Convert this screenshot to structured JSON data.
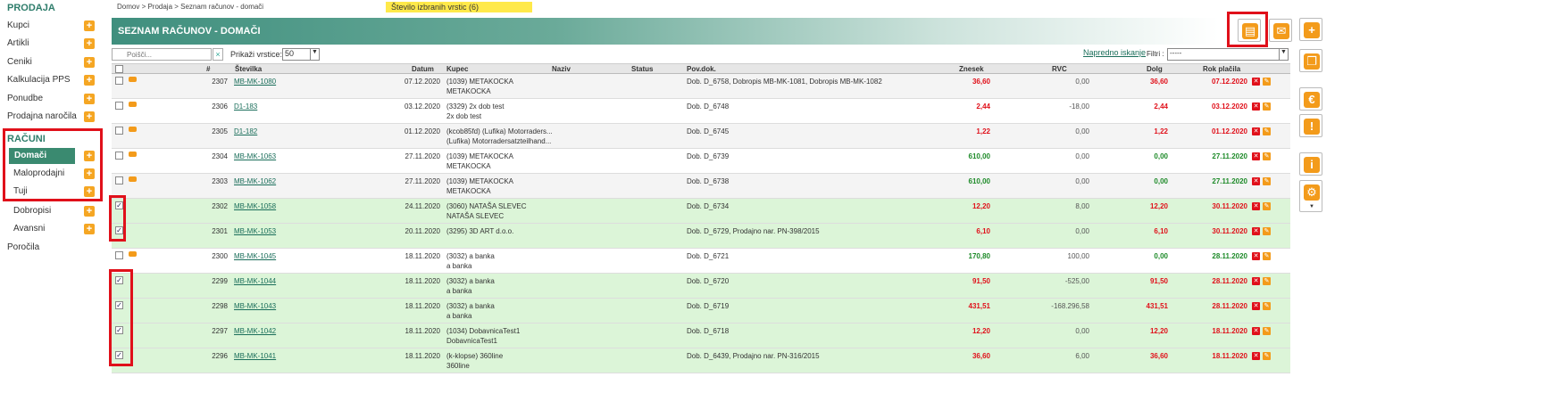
{
  "sidebar": {
    "prodaja_title": "PRODAJA",
    "items": [
      {
        "label": "Kupci",
        "name": "sidebar-item-kupci"
      },
      {
        "label": "Artikli",
        "name": "sidebar-item-artikli"
      },
      {
        "label": "Ceniki",
        "name": "sidebar-item-ceniki"
      },
      {
        "label": "Kalkulacija PPS",
        "name": "sidebar-item-kalkulacija"
      },
      {
        "label": "Ponudbe",
        "name": "sidebar-item-ponudbe"
      },
      {
        "label": "Prodajna naročila",
        "name": "sidebar-item-narocila"
      }
    ],
    "racuni_title": "RAČUNI",
    "racuni_items": [
      {
        "label": "Domači"
      },
      {
        "label": "Maloprodajni"
      },
      {
        "label": "Tuji"
      }
    ],
    "dobropisi": "Dobropisi",
    "avansni": "Avansni",
    "porocila": "Poročila"
  },
  "breadcrumb": "Domov  >  Prodaja  >  Seznam računov - domači",
  "selected_count": "Število izbranih vrstic (6)",
  "title": "SEZNAM RAČUNOV - DOMAČI",
  "search": {
    "placeholder": "Poišči...",
    "clear": "×"
  },
  "showrows": {
    "label": "Prikaži vrstice:",
    "value": "50"
  },
  "advanced_search": "Napredno iskanje",
  "filter": {
    "label": "Filtri :",
    "value": "-----"
  },
  "columns": {
    "num": "#",
    "stevilka": "Številka",
    "datum": "Datum",
    "kupec": "Kupec",
    "naziv": "Naziv",
    "status": "Status",
    "povdok": "Pov.dok.",
    "znesek": "Znesek",
    "rvc": "RVC",
    "dolg": "Dolg",
    "rok": "Rok plačila"
  },
  "rows": [
    {
      "num": "2307",
      "st": "MB-MK-1080",
      "datum": "07.12.2020",
      "k1": "(1039) METAKOCKA",
      "k2": "METAKOCKA",
      "pov": "Dob. D_6758, Dobropis MB-MK-1081, Dobropis MB-MK-1082",
      "zn": "36,60",
      "rvc": "0,00",
      "dolg": "36,60",
      "rok": "07.12.2020",
      "color": "red",
      "sel": false,
      "bg": "gray",
      "print": true
    },
    {
      "num": "2306",
      "st": "D1-183",
      "datum": "03.12.2020",
      "k1": "(3329) 2x dob test",
      "k2": "2x dob test",
      "pov": "Dob. D_6748",
      "zn": "2,44",
      "rvc": "-18,00",
      "dolg": "2,44",
      "rok": "03.12.2020",
      "color": "red",
      "sel": false,
      "bg": "white",
      "print": true
    },
    {
      "num": "2305",
      "st": "D1-182",
      "datum": "01.12.2020",
      "k1": "(kcob85fd) (Lufika) Motorraders...",
      "k2": "(Lufika) Motorradersatzteilhand...",
      "pov": "Dob. D_6745",
      "zn": "1,22",
      "rvc": "0,00",
      "dolg": "1,22",
      "rok": "01.12.2020",
      "color": "red",
      "sel": false,
      "bg": "gray",
      "print": true
    },
    {
      "num": "2304",
      "st": "MB-MK-1063",
      "datum": "27.11.2020",
      "k1": "(1039) METAKOCKA",
      "k2": "METAKOCKA",
      "pov": "Dob. D_6739",
      "zn": "610,00",
      "rvc": "0,00",
      "dolg": "0,00",
      "rok": "27.11.2020",
      "color": "green",
      "sel": false,
      "bg": "white",
      "print": true
    },
    {
      "num": "2303",
      "st": "MB-MK-1062",
      "datum": "27.11.2020",
      "k1": "(1039) METAKOCKA",
      "k2": "METAKOCKA",
      "pov": "Dob. D_6738",
      "zn": "610,00",
      "rvc": "0,00",
      "dolg": "0,00",
      "rok": "27.11.2020",
      "color": "green",
      "sel": false,
      "bg": "gray",
      "print": true
    },
    {
      "num": "2302",
      "st": "MB-MK-1058",
      "datum": "24.11.2020",
      "k1": "(3060) NATAŠA SLEVEC",
      "k2": "NATAŠA SLEVEC",
      "pov": "Dob. D_6734",
      "zn": "12,20",
      "rvc": "8,00",
      "dolg": "12,20",
      "rok": "30.11.2020",
      "color": "red",
      "sel": true,
      "bg": "sel",
      "print": false
    },
    {
      "num": "2301",
      "st": "MB-MK-1053",
      "datum": "20.11.2020",
      "k1": "(3295) 3D ART d.o.o.",
      "k2": "",
      "pov": "Dob. D_6729, Prodajno nar. PN-398/2015",
      "zn": "6,10",
      "rvc": "0,00",
      "dolg": "6,10",
      "rok": "30.11.2020",
      "color": "red",
      "sel": true,
      "bg": "sel",
      "print": false
    },
    {
      "num": "2300",
      "st": "MB-MK-1045",
      "datum": "18.11.2020",
      "k1": "(3032) a banka",
      "k2": "a banka",
      "pov": "Dob. D_6721",
      "zn": "170,80",
      "rvc": "100,00",
      "dolg": "0,00",
      "rok": "28.11.2020",
      "color": "green",
      "sel": false,
      "bg": "white",
      "print": true
    },
    {
      "num": "2299",
      "st": "MB-MK-1044",
      "datum": "18.11.2020",
      "k1": "(3032) a banka",
      "k2": "a banka",
      "pov": "Dob. D_6720",
      "zn": "91,50",
      "rvc": "-525,00",
      "dolg": "91,50",
      "rok": "28.11.2020",
      "color": "red",
      "sel": true,
      "bg": "sel",
      "print": false
    },
    {
      "num": "2298",
      "st": "MB-MK-1043",
      "datum": "18.11.2020",
      "k1": "(3032) a banka",
      "k2": "a banka",
      "pov": "Dob. D_6719",
      "zn": "431,51",
      "rvc": "-168.296,58",
      "dolg": "431,51",
      "rok": "28.11.2020",
      "color": "red",
      "sel": true,
      "bg": "sel",
      "print": false
    },
    {
      "num": "2297",
      "st": "MB-MK-1042",
      "datum": "18.11.2020",
      "k1": "(1034) DobavnicaTest1",
      "k2": "DobavnicaTest1",
      "pov": "Dob. D_6718",
      "zn": "12,20",
      "rvc": "0,00",
      "dolg": "12,20",
      "rok": "18.11.2020",
      "color": "red",
      "sel": true,
      "bg": "sel",
      "print": false
    },
    {
      "num": "2296",
      "st": "MB-MK-1041",
      "datum": "18.11.2020",
      "k1": "(k-klopse) 360line",
      "k2": "360line",
      "pov": "Dob. D_6439, Prodajno nar. PN-316/2015",
      "zn": "36,60",
      "rvc": "6,00",
      "dolg": "36,60",
      "rok": "18.11.2020",
      "color": "red",
      "sel": true,
      "bg": "sel",
      "print": false
    }
  ]
}
